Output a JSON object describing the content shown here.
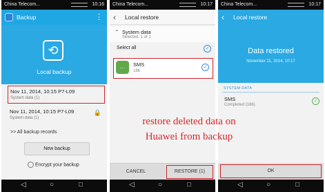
{
  "status": {
    "carrier": "China Telecom...",
    "time1": "10:16",
    "time2": "10:17",
    "time3": "10:17"
  },
  "screen1": {
    "title": "Backup",
    "menu_glyph": "⋮",
    "hero_label": "Local backup",
    "records": [
      {
        "title": "Nov 11, 2014, 10:15 P7-L09",
        "sub": "System data (1)"
      },
      {
        "title": "Nov 11, 2014, 10:15 P7-L09",
        "sub": "System data (1)"
      }
    ],
    "all_records": ">> All backup records",
    "new_backup": "New backup",
    "encrypt": "Encrypt your backup"
  },
  "screen2": {
    "title": "Local restore",
    "system_data": "System data",
    "system_sub": "Selected: 1 of 1",
    "select_all": "Select all",
    "sms_name": "SMS",
    "sms_count": "186",
    "cancel": "CANCEL",
    "restore": "RESTORE (1)"
  },
  "screen3": {
    "title": "Local restore",
    "restored": "Data restored",
    "date": "November 11, 2014, 10:17",
    "section": "SYSTEM DATA",
    "sms_name": "SMS",
    "sms_status": "Completed (186)",
    "ok": "OK"
  },
  "caption": {
    "line1": "restore deleted data on",
    "line2": "Huawei from backup"
  },
  "icons": {
    "back": "‹",
    "check": "✓",
    "lock": "🔒",
    "nav_back": "◁",
    "nav_home": "○",
    "nav_recent": "□"
  },
  "colors": {
    "accent_blue": "#2aa9e3",
    "highlight_red": "#c9242b",
    "caption_red": "#d4282c"
  }
}
